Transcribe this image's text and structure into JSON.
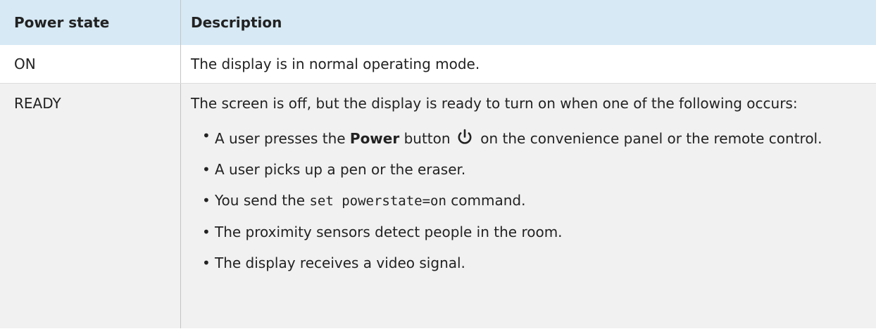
{
  "table": {
    "headers": {
      "col1": "Power state",
      "col2": "Description"
    },
    "rows": [
      {
        "state": "ON",
        "description": "The display is in normal operating mode."
      },
      {
        "state": "READY",
        "description": "The screen is off, but the display is ready to turn on when one of the following occurs:",
        "conditions": {
          "item1": {
            "before": "A user presses the ",
            "bold": "Power",
            "middle": " button ",
            "icon": "power-icon",
            "after": " on the convenience panel or the remote control."
          },
          "item2": "A user picks up a pen or the eraser.",
          "item3": {
            "before": "You send the ",
            "code": "set powerstate=on",
            "after": " command."
          },
          "item4": "The proximity sensors detect people in the room.",
          "item5": "The display receives a video signal."
        },
        "bullet": "•"
      }
    ]
  },
  "colors": {
    "header_bg": "#d6e9f5",
    "alt_row_bg": "#f1f1f1",
    "text": "#222222"
  }
}
